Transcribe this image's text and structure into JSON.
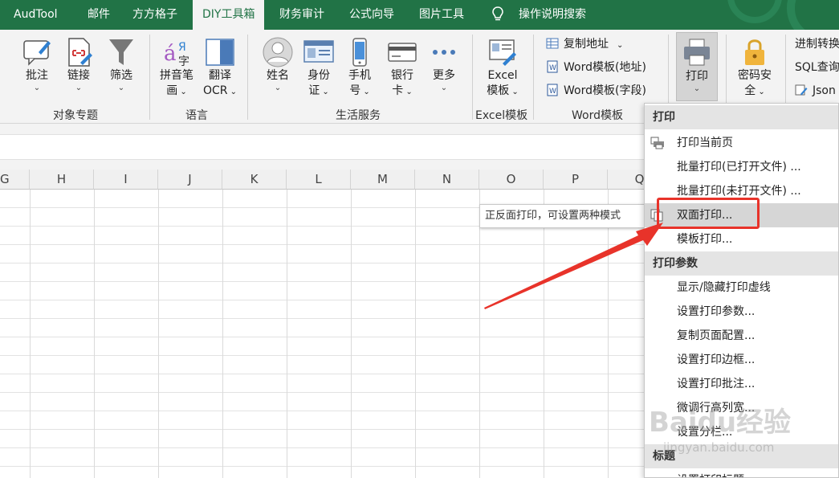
{
  "tabs": [
    "AudTool",
    "邮件",
    "方方格子",
    "DIY工具箱",
    "财务审计",
    "公式向导",
    "图片工具",
    "操作说明搜索"
  ],
  "active_tab": "DIY工具箱",
  "ribbon": {
    "objects": {
      "pizhu": "批注",
      "lianjie": "链接",
      "shaixuan": "筛选",
      "group": "对象专题"
    },
    "language": {
      "pinyin_1": "拼音笔",
      "pinyin_2": "画",
      "fanyi_1": "翻译",
      "fanyi_2": "OCR",
      "group": "语言"
    },
    "life": {
      "xingming": "姓名",
      "shenfen_1": "身份",
      "shenfen_2": "证",
      "shouji_1": "手机",
      "shouji_2": "号",
      "yinhang_1": "银行",
      "yinhang_2": "卡",
      "gengduo": "更多",
      "group": "生活服务"
    },
    "excel": {
      "label_1": "Excel",
      "label_2": "模板",
      "group": "Excel模板"
    },
    "word": {
      "copy_addr": "复制地址",
      "word_addr": "Word模板(地址)",
      "word_field": "Word模板(字段)",
      "group": "Word模板"
    },
    "print": {
      "label": "打印"
    },
    "password": {
      "label_1": "密码安",
      "label_2": "全"
    },
    "right": {
      "r1": "进制转换",
      "r2": "SQL查询",
      "r3": "Json"
    }
  },
  "columns": [
    "G",
    "H",
    "I",
    "J",
    "K",
    "L",
    "M",
    "N",
    "O",
    "P",
    "Q"
  ],
  "tooltip": "正反面打印，可设置两种模式",
  "menu": {
    "section1": "打印",
    "items1": [
      "打印当前页",
      "批量打印(已打开文件) ...",
      "批量打印(未打开文件) ...",
      "双面打印...",
      "模板打印..."
    ],
    "section2": "打印参数",
    "items2": [
      "显示/隐藏打印虚线",
      "设置打印参数...",
      "复制页面配置...",
      "设置打印边框...",
      "设置打印批注...",
      "微调行高列宽...",
      "设置分栏..."
    ],
    "section3": "标题",
    "items3": [
      "设置打印标题..."
    ]
  },
  "watermark": {
    "brand": "Baidu经验",
    "url": "jingyan.baidu.com"
  },
  "colors": {
    "accent": "#217346",
    "highlight_box": "#e8332a"
  }
}
